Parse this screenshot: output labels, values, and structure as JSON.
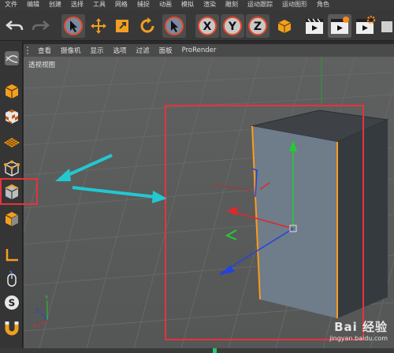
{
  "menubar": {
    "items": [
      "文件",
      "编辑",
      "创建",
      "选择",
      "工具",
      "网格",
      "捕捉",
      "动画",
      "模拟",
      "渲染",
      "雕刻",
      "运动跟踪",
      "运动图形",
      "角色"
    ]
  },
  "toolbar": {
    "axis_x": "X",
    "axis_y": "Y",
    "axis_z": "Z"
  },
  "viewport_menu": {
    "items": [
      "查看",
      "摄像机",
      "显示",
      "选项",
      "过滤",
      "面板",
      "ProRender"
    ]
  },
  "viewport": {
    "label": "透视视图"
  },
  "watermark": {
    "brand": "Bai 经验",
    "url": "jingyan.baidu.com"
  },
  "colors": {
    "annotation_red": "#e8323c",
    "arrow_cyan": "#22c8d0",
    "selection_orange": "#ff9a1a",
    "axis_x": "#e02828",
    "axis_y": "#22cc33",
    "axis_z": "#2244dd"
  }
}
